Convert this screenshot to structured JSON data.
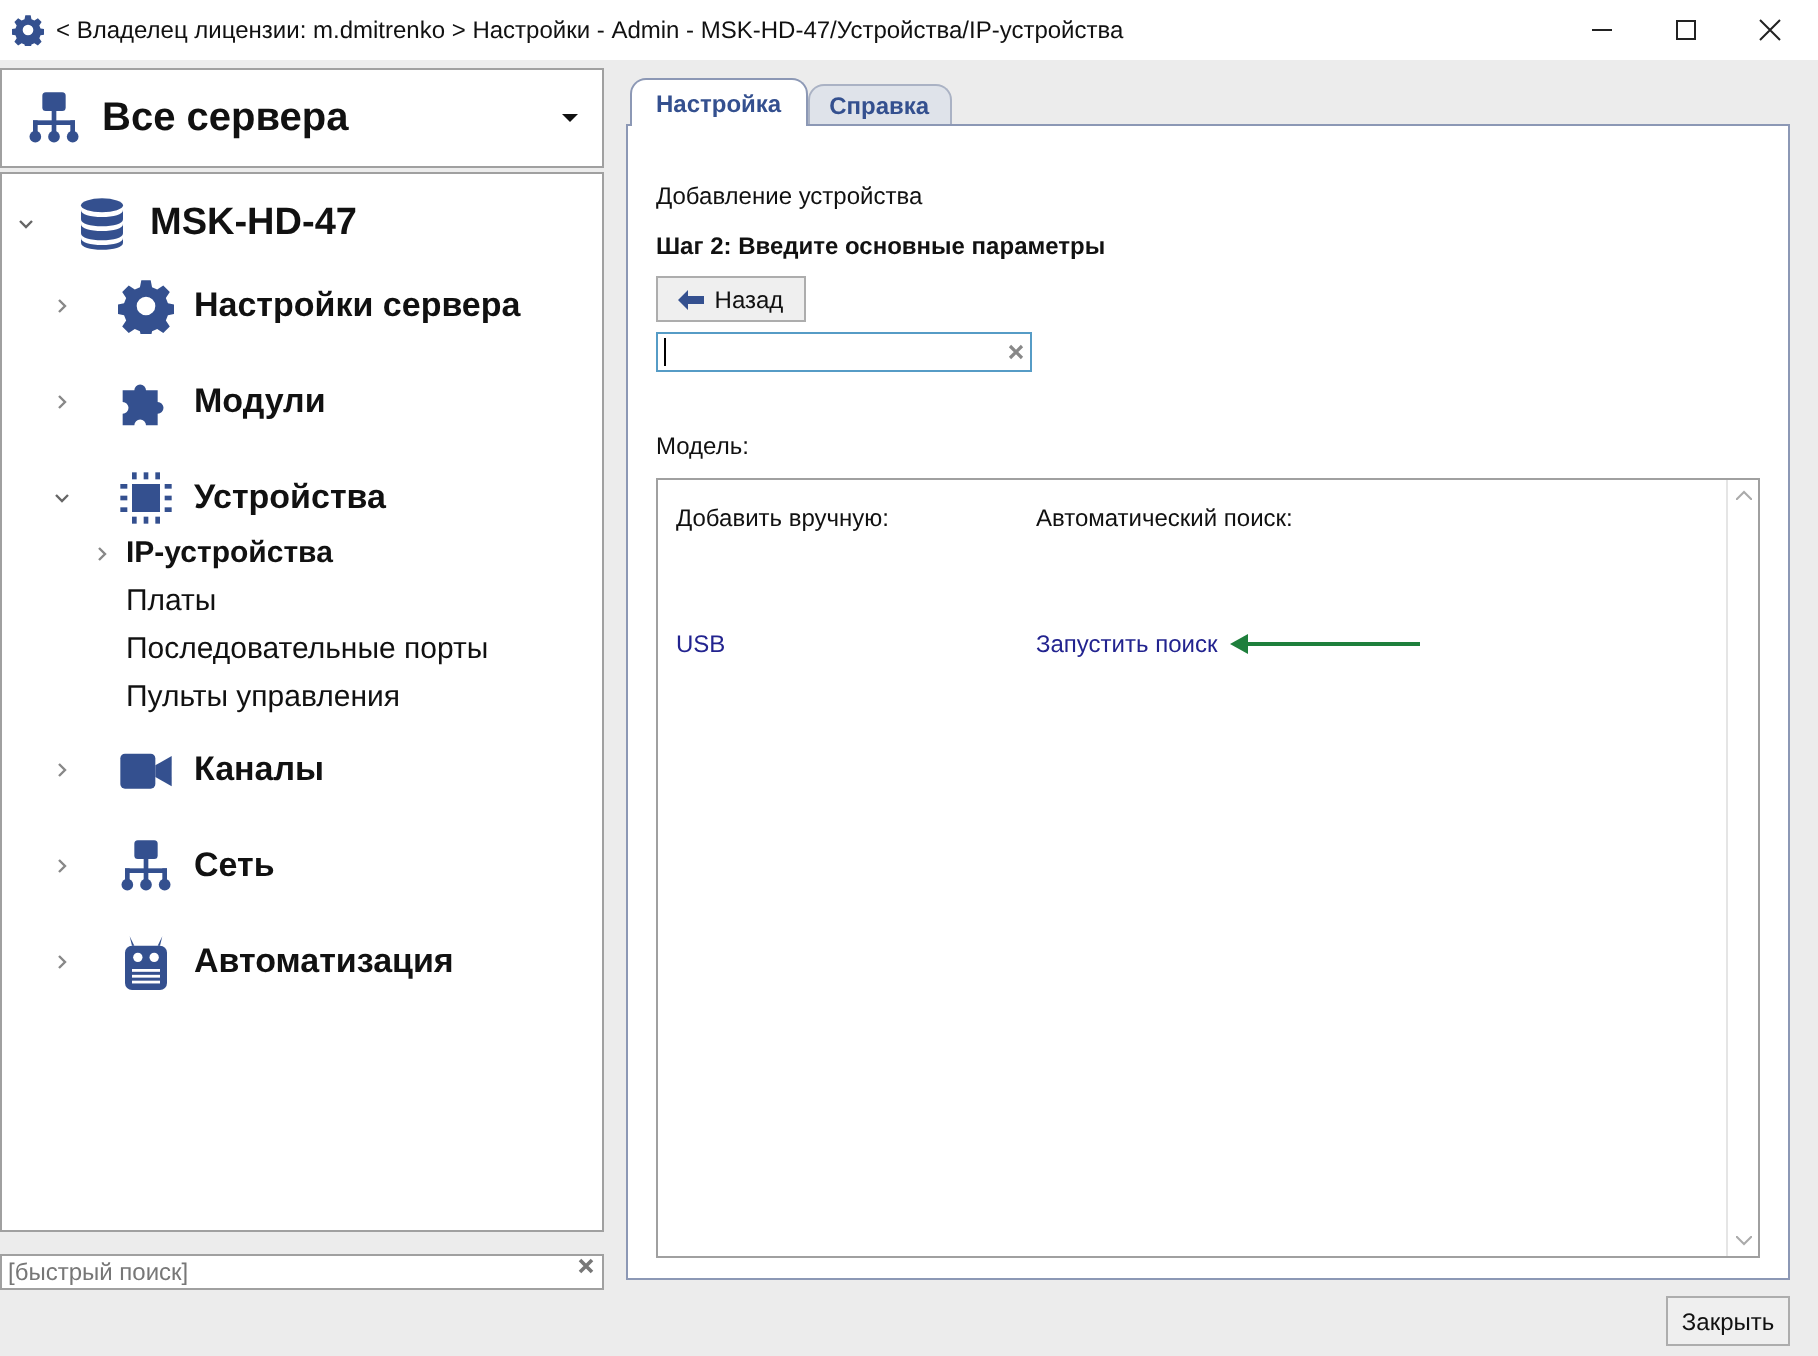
{
  "window": {
    "title": "< Владелец лицензии: m.dmitrenko > Настройки - Admin - MSK-HD-47/Устройства/IP-устройства"
  },
  "server_selector": {
    "value": "Все сервера"
  },
  "tree": [
    {
      "label": "MSK-HD-47",
      "kind": "database",
      "expanded": true,
      "children": [
        {
          "label": "Настройки сервера",
          "kind": "gear",
          "expanded": false
        },
        {
          "label": "Модули",
          "kind": "puzzle",
          "expanded": false
        },
        {
          "label": "Устройства",
          "kind": "chip",
          "expanded": true,
          "children": [
            {
              "label": "IP-устройства",
              "expandable": true,
              "selected": true
            },
            {
              "label": "Платы",
              "expandable": false,
              "selected": false
            },
            {
              "label": "Последовательные порты",
              "expandable": false,
              "selected": false
            },
            {
              "label": "Пульты управления",
              "expandable": false,
              "selected": false
            }
          ]
        },
        {
          "label": "Каналы",
          "kind": "camera",
          "expanded": false
        },
        {
          "label": "Сеть",
          "kind": "network",
          "expanded": false
        },
        {
          "label": "Автоматизация",
          "kind": "robot",
          "expanded": false
        }
      ]
    }
  ],
  "quick_search": {
    "placeholder": "[быстрый поиск]"
  },
  "tabs": [
    {
      "label": "Настройка",
      "selected": true
    },
    {
      "label": "Справка",
      "selected": false
    }
  ],
  "heading": "Добавление устройства",
  "step": "Шаг 2: Введите основные параметры",
  "back_button": "Назад",
  "model_label": "Модель:",
  "model_columns": [
    {
      "header": "Добавить вручную:",
      "links": [
        "USB"
      ]
    },
    {
      "header": "Автоматический поиск:",
      "links": [
        "Запустить поиск"
      ]
    }
  ],
  "close_button": "Закрыть"
}
